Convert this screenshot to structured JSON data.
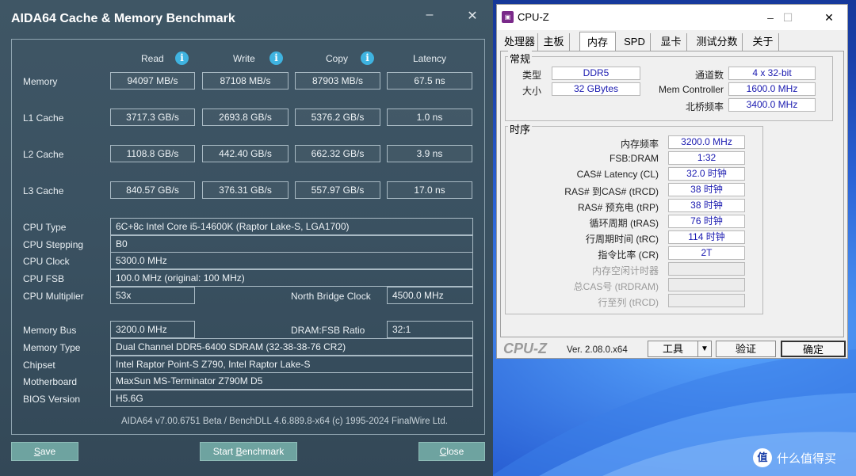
{
  "aida": {
    "title": "AIDA64 Cache & Memory Benchmark",
    "minimize": "–",
    "close_glyph": "✕",
    "columns": [
      "Read",
      "Write",
      "Copy",
      "Latency"
    ],
    "rows": [
      {
        "label": "Memory",
        "values": [
          "94097 MB/s",
          "87108 MB/s",
          "87903 MB/s",
          "67.5 ns"
        ]
      },
      {
        "label": "L1 Cache",
        "values": [
          "3717.3 GB/s",
          "2693.8 GB/s",
          "5376.2 GB/s",
          "1.0 ns"
        ]
      },
      {
        "label": "L2 Cache",
        "values": [
          "1108.8 GB/s",
          "442.40 GB/s",
          "662.32 GB/s",
          "3.9 ns"
        ]
      },
      {
        "label": "L3 Cache",
        "values": [
          "840.57 GB/s",
          "376.31 GB/s",
          "557.97 GB/s",
          "17.0 ns"
        ]
      }
    ],
    "cpu": {
      "type_label": "CPU Type",
      "type": "6C+8c Intel Core i5-14600K  (Raptor Lake-S, LGA1700)",
      "stepping_label": "CPU Stepping",
      "stepping": "B0",
      "clock_label": "CPU Clock",
      "clock": "5300.0 MHz",
      "fsb_label": "CPU FSB",
      "fsb": "100.0 MHz  (original: 100 MHz)",
      "mult_label": "CPU Multiplier",
      "mult": "53x",
      "nb_label": "North Bridge Clock",
      "nb": "4500.0 MHz"
    },
    "mem": {
      "bus_label": "Memory Bus",
      "bus": "3200.0 MHz",
      "ratio_label": "DRAM:FSB Ratio",
      "ratio": "32:1",
      "type_label": "Memory Type",
      "type": "Dual Channel DDR5-6400 SDRAM  (32-38-38-76 CR2)",
      "chipset_label": "Chipset",
      "chipset": "Intel Raptor Point-S Z790, Intel Raptor Lake-S",
      "mb_label": "Motherboard",
      "mb": "MaxSun MS-Terminator Z790M D5",
      "bios_label": "BIOS Version",
      "bios": "H5.6G"
    },
    "footer": "AIDA64 v7.00.6751 Beta / BenchDLL 4.6.889.8-x64  (c) 1995-2024 FinalWire Ltd.",
    "buttons": {
      "save_first": "S",
      "save_rest": "ave",
      "start_pre": "Start ",
      "start_u": "B",
      "start_post": "enchmark",
      "close_first": "C",
      "close_rest": "lose"
    }
  },
  "cpuz": {
    "title": "CPU-Z",
    "tabs": [
      "处理器",
      "主板",
      "内存",
      "SPD",
      "显卡",
      "测试分数",
      "关于"
    ],
    "general_label": "常规",
    "general": {
      "type_label": "类型",
      "type": "DDR5",
      "size_label": "大小",
      "size": "32 GBytes",
      "channels_label": "通道数",
      "channels": "4 x 32-bit",
      "memctrl_label": "Mem Controller",
      "memctrl": "1600.0 MHz",
      "nb_label": "北桥频率",
      "nb": "3400.0 MHz"
    },
    "timing_label": "时序",
    "timings": [
      {
        "label": "内存频率",
        "value": "3200.0 MHz"
      },
      {
        "label": "FSB:DRAM",
        "value": "1:32"
      },
      {
        "label": "CAS# Latency (CL)",
        "value": "32.0 时钟"
      },
      {
        "label": "RAS# 到CAS# (tRCD)",
        "value": "38 时钟"
      },
      {
        "label": "RAS# 预充电 (tRP)",
        "value": "38 时钟"
      },
      {
        "label": "循环周期 (tRAS)",
        "value": "76 时钟"
      },
      {
        "label": "行周期时间 (tRC)",
        "value": "114 时钟"
      },
      {
        "label": "指令比率 (CR)",
        "value": "2T"
      },
      {
        "label": "内存空闲计时器",
        "value": ""
      },
      {
        "label": "总CAS号 (tRDRAM)",
        "value": ""
      },
      {
        "label": "行至列 (tRCD)",
        "value": ""
      }
    ],
    "footer": {
      "logo": "CPU-Z",
      "version": "Ver. 2.08.0.x64",
      "tools": "工具",
      "dropdown": "▼",
      "validate": "验证",
      "ok": "确定"
    }
  },
  "watermark": {
    "icon": "值",
    "text": "什么值得买"
  }
}
